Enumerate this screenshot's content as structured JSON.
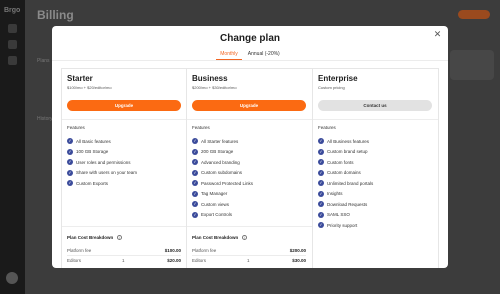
{
  "background": {
    "logo": "Brgo",
    "page_title": "Billing",
    "left_text_1": "Plans",
    "left_text_2": "History"
  },
  "modal": {
    "title": "Change plan",
    "close_icon": "close-icon",
    "tabs": [
      {
        "label": "Monthly",
        "active": true
      },
      {
        "label": "Annual (-20%)",
        "active": false
      }
    ]
  },
  "plans": [
    {
      "name": "Starter",
      "price": "$100/mo + $20/editor/mo",
      "button": "Upgrade",
      "features_title": "Features",
      "features": [
        "All Basic features",
        "100 GB Storage",
        "User roles and permissions",
        "Share with users on your team",
        "Custom Exports"
      ],
      "cost": {
        "title": "Plan Cost Breakdown",
        "rows": [
          {
            "label": "Platform fee",
            "qty": "",
            "amount": "$100.00"
          },
          {
            "label": "Editors",
            "qty": "1",
            "amount": "$20.00"
          }
        ]
      }
    },
    {
      "name": "Business",
      "price": "$200/mo + $30/editor/mo",
      "button": "Upgrade",
      "features_title": "Features",
      "features": [
        "All Starter features",
        "200 GB Storage",
        "Advanced branding",
        "Custom subdomains",
        "Password Protected Links",
        "Tag Manager",
        "Custom views",
        "Export Controls"
      ],
      "cost": {
        "title": "Plan Cost Breakdown",
        "rows": [
          {
            "label": "Platform fee",
            "qty": "",
            "amount": "$200.00"
          },
          {
            "label": "Editors",
            "qty": "1",
            "amount": "$30.00"
          }
        ]
      }
    },
    {
      "name": "Enterprise",
      "price": "Custom pricing",
      "button": "Contact us",
      "features_title": "Features",
      "features": [
        "All Business features",
        "Custom brand setup",
        "Custom fonts",
        "Custom domains",
        "Unlimited brand portals",
        "Insights",
        "Download Requests",
        "SAML SSO",
        "Priority support"
      ]
    }
  ],
  "colors": {
    "accent": "#fb6a12",
    "check": "#3b4b9b",
    "contact_button": "#e2e2e2"
  }
}
